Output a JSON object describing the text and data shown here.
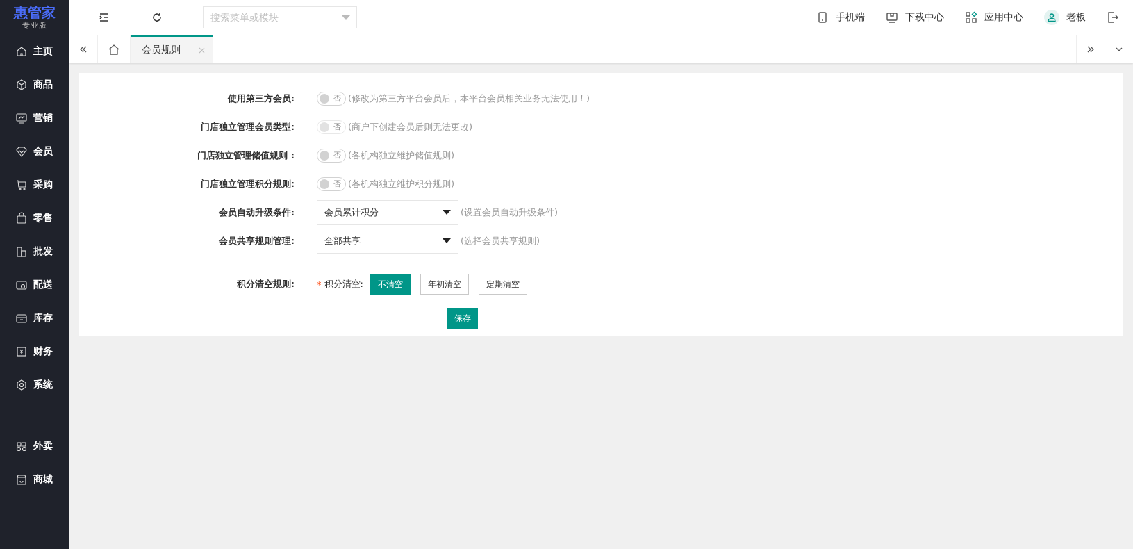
{
  "logo": {
    "title": "惠管家",
    "edition": "专业版"
  },
  "sidebar": {
    "items": [
      {
        "label": "主页",
        "selected": false
      },
      {
        "label": "商品",
        "selected": false
      },
      {
        "label": "营销",
        "selected": false
      },
      {
        "label": "会员",
        "selected": false
      },
      {
        "label": "采购",
        "selected": false
      },
      {
        "label": "零售",
        "selected": false
      },
      {
        "label": "批发",
        "selected": false
      },
      {
        "label": "配送",
        "selected": false
      },
      {
        "label": "库存",
        "selected": false
      },
      {
        "label": "财务",
        "selected": false
      },
      {
        "label": "系统",
        "selected": false
      }
    ],
    "bottom_items": [
      {
        "label": "外卖",
        "selected": false
      },
      {
        "label": "商城",
        "selected": false
      }
    ]
  },
  "topbar": {
    "search": {
      "placeholder": "搜索菜单或模块"
    },
    "links": [
      "手机端",
      "下载中心",
      "应用中心"
    ],
    "user": "老板"
  },
  "tabs": [
    {
      "label": "会员规则",
      "selected": true
    }
  ],
  "form": {
    "rows": [
      {
        "kind": "toggle",
        "label": "使用第三方会员:",
        "on": false,
        "disabled": false,
        "state_text": "否",
        "hint": "(修改为第三方平台会员后，本平台会员相关业务无法使用！)"
      },
      {
        "kind": "toggle",
        "label": "门店独立管理会员类型:",
        "on": false,
        "disabled": true,
        "state_text": "否",
        "hint": "(商户下创建会员后则无法更改)"
      },
      {
        "kind": "toggle",
        "label": "门店独立管理储值规则 :",
        "on": false,
        "disabled": false,
        "state_text": "否",
        "hint": "(各机构独立维护储值规则)"
      },
      {
        "kind": "toggle",
        "label": "门店独立管理积分规则:",
        "on": false,
        "disabled": false,
        "state_text": "否",
        "hint": "(各机构独立维护积分规则)"
      },
      {
        "kind": "select",
        "label": "会员自动升级条件:",
        "value": "会员累计积分",
        "hint": "(设置会员自动升级条件)"
      },
      {
        "kind": "select",
        "label": "会员共享规则管理:",
        "value": "全部共享",
        "hint": "(选择会员共享规则)"
      },
      {
        "kind": "choice",
        "label": "积分清空规则:",
        "required_mark": "*",
        "field_label": "积分清空:",
        "options": [
          {
            "label": "不清空",
            "selected": true
          },
          {
            "label": "年初清空",
            "selected": false
          },
          {
            "label": "定期清空",
            "selected": false
          }
        ]
      }
    ],
    "save": "保存"
  }
}
